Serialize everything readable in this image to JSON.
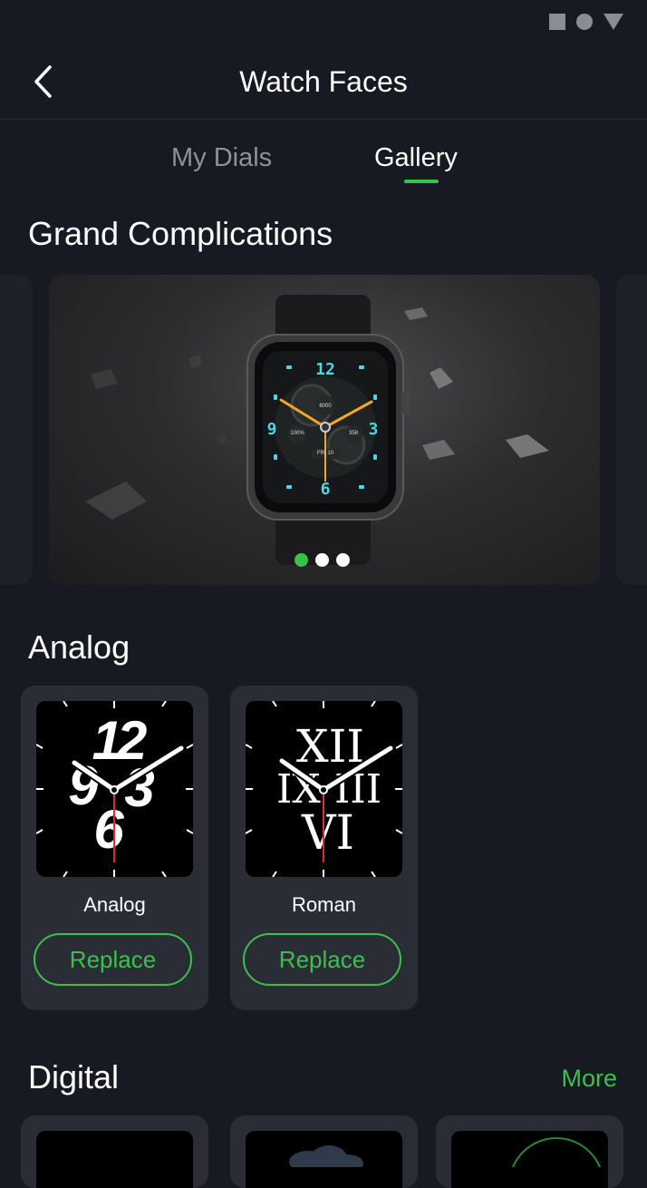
{
  "status_bar": {
    "icons": [
      "square-icon",
      "circle-icon",
      "triangle-icon"
    ]
  },
  "header": {
    "title": "Watch Faces",
    "back_icon": "chevron-left-icon"
  },
  "tabs": [
    {
      "label": "My Dials",
      "active": false
    },
    {
      "label": "Gallery",
      "active": true
    }
  ],
  "featured": {
    "title": "Grand Complications",
    "watch_face_text": {
      "top": "12",
      "right": "3",
      "bottom": "6",
      "left": "9",
      "steps": "8000",
      "battery": "100%",
      "heart": "358",
      "date": "FRI 10"
    },
    "carousel": {
      "count": 3,
      "active_index": 0
    }
  },
  "analog": {
    "title": "Analog",
    "items": [
      {
        "name": "Analog",
        "button": "Replace",
        "numerals": [
          "12",
          "9",
          "3",
          "6"
        ]
      },
      {
        "name": "Roman",
        "button": "Replace",
        "numerals": [
          "XII",
          "IX",
          "III",
          "VI"
        ]
      }
    ]
  },
  "digital": {
    "title": "Digital",
    "more_label": "More"
  },
  "colors": {
    "background": "#181a23",
    "card": "#2a2c36",
    "accent": "#37c34a",
    "inactive_text": "#8e919b"
  }
}
